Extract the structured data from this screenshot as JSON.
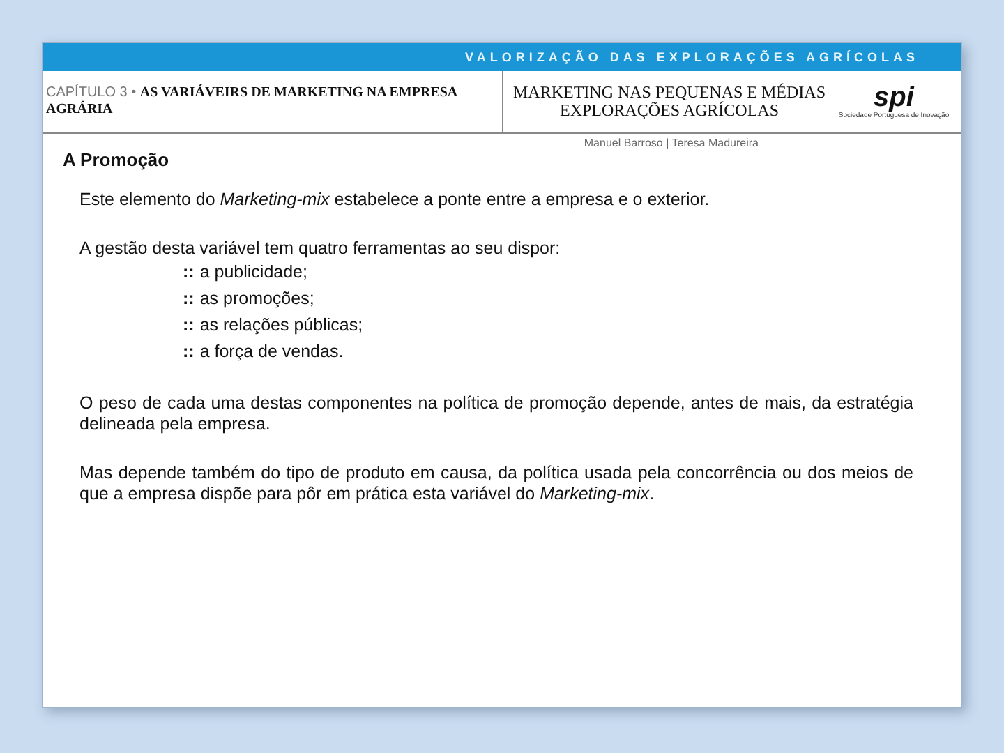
{
  "banner": {
    "title": "VALORIZAÇÃO DAS EXPLORAÇÕES AGRÍCOLAS"
  },
  "header": {
    "chapter": "CAPÍTULO 3 • **AS VARIÁVEIRS DE MARKETING NA EMPRESA AGRÁRIA**",
    "book_title": "MARKETING NAS PEQUENAS E MÉDIAS EXPLORAÇÕES AGRÍCOLAS",
    "logo": "spi",
    "logo_caption": "Sociedade Portuguesa de Inovação",
    "authors": "Manuel Barroso | Teresa Madureira"
  },
  "heading": "A Promoção",
  "intro": "Este elemento do *Marketing-mix* estabelece a ponte entre a empresa e o exterior.",
  "list_intro": "A gestão desta variável tem quatro ferramentas ao seu dispor:",
  "list_items": [
    {
      "bullet": "::",
      "text": "a publicidade;"
    },
    {
      "bullet": "::",
      "text": "as promoções;"
    },
    {
      "bullet": "::",
      "text": "as relações públicas;"
    },
    {
      "bullet": "::",
      "text": "a força de vendas."
    }
  ],
  "paragraphs": [
    "O peso de cada uma destas componentes na política de promoção depende, antes de mais, da estratégia delineada pela empresa.",
    "Mas depende também do tipo de produto em causa, da política usada pela concorrência ou dos meios de que a empresa dispõe para pôr em prática esta variável do *Marketing-mix*."
  ]
}
